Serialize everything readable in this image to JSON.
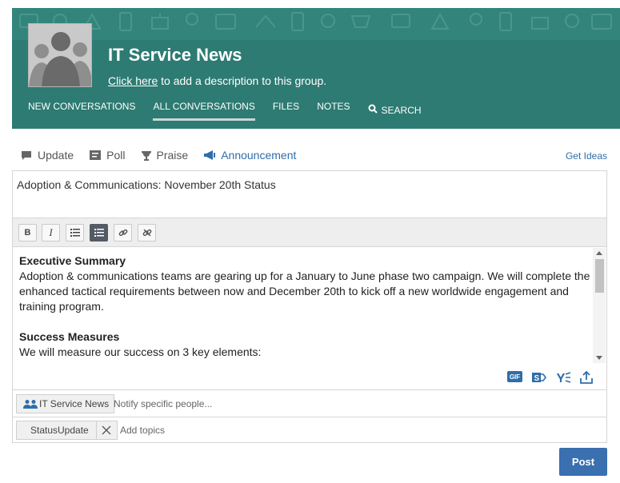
{
  "header": {
    "group_title": "IT Service News",
    "desc_link": "Click here",
    "desc_rest": " to add a description to this group.",
    "nav": [
      "NEW CONVERSATIONS",
      "ALL CONVERSATIONS",
      "FILES",
      "NOTES",
      "SEARCH"
    ],
    "active_tab": "ALL CONVERSATIONS",
    "color": "#2d7b72"
  },
  "publisher": {
    "tabs": [
      "Update",
      "Poll",
      "Praise",
      "Announcement"
    ],
    "active": "Announcement",
    "get_ideas": "Get Ideas"
  },
  "composer": {
    "subject": "Adoption & Communications: November 20th Status",
    "toolbar": [
      "bold-button",
      "italic-button",
      "bullet-list-button",
      "numbered-list-button",
      "link-button",
      "unlink-button"
    ],
    "body": {
      "h1": "Executive Summary",
      "p1": "Adoption & communications teams are gearing up for a January to June phase two campaign. We will complete the enhanced tactical requirements between now and December 20th to kick off a new worldwide engagement and training program.",
      "h2": "Success Measures",
      "p2": "We will measure our success on 3 key elements:"
    },
    "gif_label": "GIF",
    "group_chip": "IT Service News",
    "notify_placeholder": "Notify specific people...",
    "topic": "StatusUpdate",
    "topics_placeholder": "Add topics"
  },
  "post_label": "Post",
  "accent": "#3a6fb0"
}
